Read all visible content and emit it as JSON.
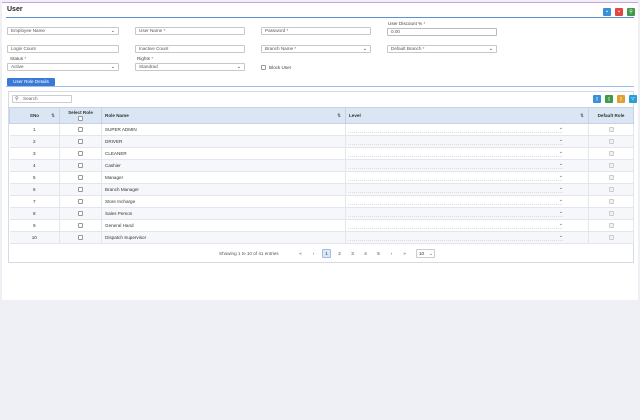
{
  "header": {
    "title": "User"
  },
  "toolbar": {
    "buttons": [
      {
        "name": "save",
        "color": "#3a8fd9",
        "glyph": "▪"
      },
      {
        "name": "delete",
        "color": "#e04848",
        "glyph": "▪"
      },
      {
        "name": "search",
        "color": "#3f9b4a",
        "glyph": "⚲"
      }
    ]
  },
  "form": {
    "employee_name": {
      "placeholder": "Employee Name"
    },
    "user_name": {
      "label": "User Name",
      "req": "*"
    },
    "password": {
      "label": "Password",
      "req": "*"
    },
    "user_discount": {
      "label": "User Discount %",
      "req": "*",
      "value": "0.00"
    },
    "login_count": {
      "placeholder": "Login Count"
    },
    "inactive_count": {
      "placeholder": "Inactive Count"
    },
    "branch_name": {
      "label": "Branch Name",
      "req": "*"
    },
    "default_branch": {
      "label": "Default Branch",
      "req": "*"
    },
    "status": {
      "label": "Status",
      "req": "*",
      "value": "Active"
    },
    "rights": {
      "label": "Rights",
      "req": "*",
      "value": "Standrad"
    },
    "block_user": {
      "label": "Block User"
    }
  },
  "tab": {
    "label": "User Role Details"
  },
  "grid": {
    "search_placeholder": "Search",
    "actions": [
      {
        "name": "new",
        "color": "#3a8fd9"
      },
      {
        "name": "excel",
        "color": "#3f9b4a"
      },
      {
        "name": "pdf",
        "color": "#e0a030"
      },
      {
        "name": "filter",
        "color": "#2a9fd6"
      }
    ],
    "columns": {
      "sno": "SNo",
      "select_role": "Select Role",
      "role_name": "Role Name",
      "level": "Level",
      "default_role": "Default Role"
    },
    "sort_glyph": "⇅",
    "rows": [
      {
        "sno": "1",
        "role": "SUPER ADMIN"
      },
      {
        "sno": "2",
        "role": "DRIVER"
      },
      {
        "sno": "3",
        "role": "CLEANER"
      },
      {
        "sno": "4",
        "role": "Cashier"
      },
      {
        "sno": "5",
        "role": "Manager"
      },
      {
        "sno": "6",
        "role": "Branch Manager"
      },
      {
        "sno": "7",
        "role": "Store Incharge"
      },
      {
        "sno": "8",
        "role": "Sales Person"
      },
      {
        "sno": "9",
        "role": "General Hand"
      },
      {
        "sno": "10",
        "role": "Dispatch Supervisor"
      }
    ]
  },
  "pager": {
    "info": "Showing 1 to 10 of 41 entries",
    "first": "«",
    "prev": "‹",
    "pages": [
      "1",
      "2",
      "3",
      "4",
      "5"
    ],
    "active_page": "1",
    "next": "›",
    "last": "»",
    "page_size": "10"
  }
}
